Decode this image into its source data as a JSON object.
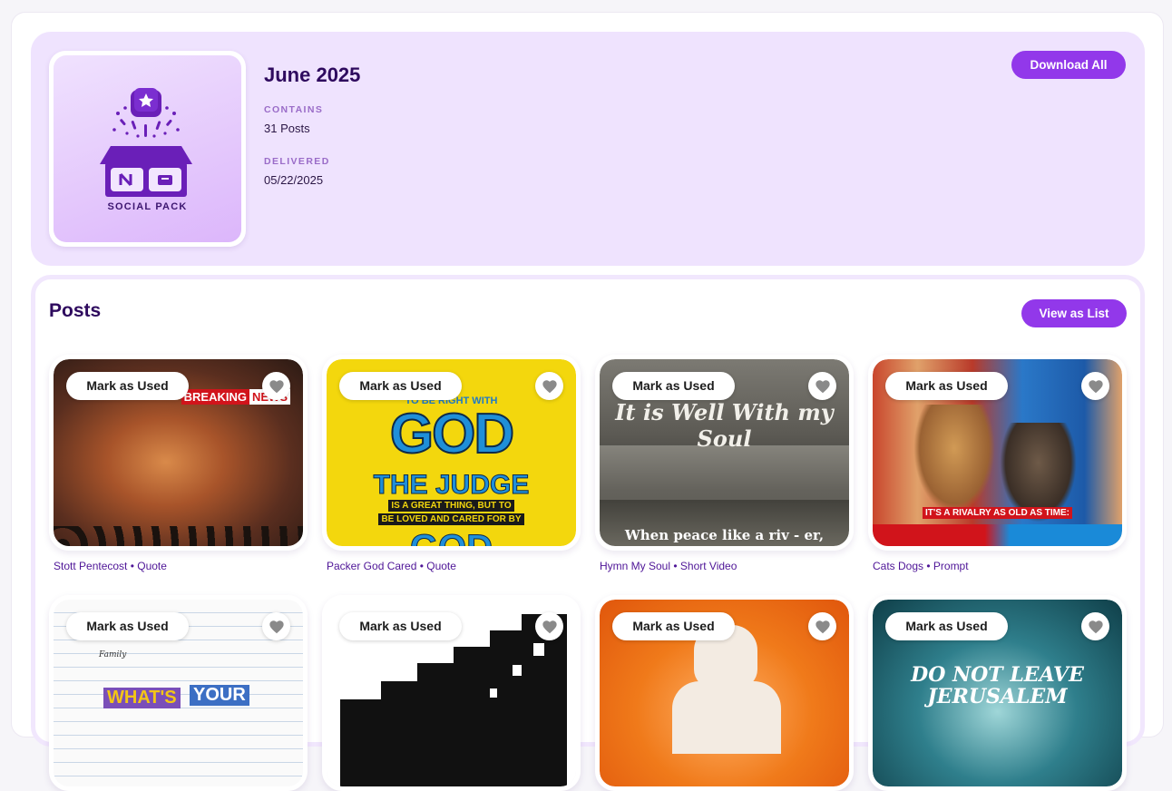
{
  "pack": {
    "cover_label": "SOCIAL PACK",
    "title": "June 2025",
    "contains_label": "CONTAINS",
    "contains_value": "31 Posts",
    "delivered_label": "DELIVERED",
    "delivered_value": "05/22/2025",
    "download_label": "Download All"
  },
  "posts": {
    "heading": "Posts",
    "view_list_label": "View as List",
    "mark_label": "Mark as Used",
    "items": [
      {
        "caption": "Stott Pentecost • Quote",
        "art_text": [
          "BREAKING",
          "NEWS"
        ]
      },
      {
        "caption": "Packer God Cared • Quote",
        "art_text": [
          "TO BE RIGHT WITH",
          "GOD",
          "THE JUDGE",
          "IS A GREAT THING, BUT TO",
          "BE LOVED AND CARED FOR BY",
          "GOD"
        ]
      },
      {
        "caption": "Hymn My Soul • Short Video",
        "art_text": [
          "It is Well With my Soul",
          "When peace like a riv - er,"
        ]
      },
      {
        "caption": "Cats Dogs • Prompt",
        "art_text": [
          "IT'S A RIVALRY AS OLD AS TIME:"
        ]
      },
      {
        "caption": "",
        "art_text": [
          "Family",
          "WHAT'S",
          "YOUR"
        ]
      },
      {
        "caption": "",
        "art_text": []
      },
      {
        "caption": "",
        "art_text": []
      },
      {
        "caption": "",
        "art_text": [
          "DO NOT LEAVE",
          "JERUSALEM"
        ]
      }
    ]
  },
  "colors": {
    "accent": "#9238ea",
    "hero_bg": "#efe3fe",
    "heading": "#2e0a5e",
    "caption": "#4e1597"
  },
  "icons": {
    "favorite": "heart-icon",
    "cover": "gift-box-icon"
  }
}
